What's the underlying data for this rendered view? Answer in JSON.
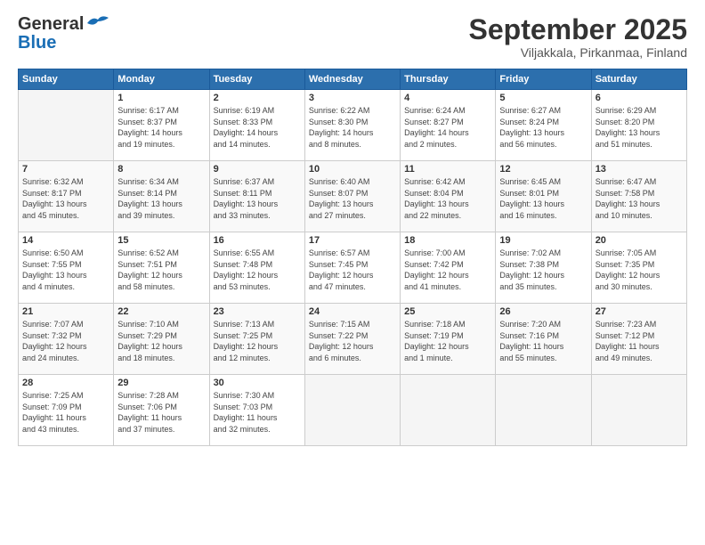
{
  "header": {
    "logo_line1": "General",
    "logo_line2": "Blue",
    "month_title": "September 2025",
    "location": "Viljakkala, Pirkanmaa, Finland"
  },
  "days_of_week": [
    "Sunday",
    "Monday",
    "Tuesday",
    "Wednesday",
    "Thursday",
    "Friday",
    "Saturday"
  ],
  "weeks": [
    [
      {
        "day": "",
        "content": ""
      },
      {
        "day": "1",
        "content": "Sunrise: 6:17 AM\nSunset: 8:37 PM\nDaylight: 14 hours\nand 19 minutes."
      },
      {
        "day": "2",
        "content": "Sunrise: 6:19 AM\nSunset: 8:33 PM\nDaylight: 14 hours\nand 14 minutes."
      },
      {
        "day": "3",
        "content": "Sunrise: 6:22 AM\nSunset: 8:30 PM\nDaylight: 14 hours\nand 8 minutes."
      },
      {
        "day": "4",
        "content": "Sunrise: 6:24 AM\nSunset: 8:27 PM\nDaylight: 14 hours\nand 2 minutes."
      },
      {
        "day": "5",
        "content": "Sunrise: 6:27 AM\nSunset: 8:24 PM\nDaylight: 13 hours\nand 56 minutes."
      },
      {
        "day": "6",
        "content": "Sunrise: 6:29 AM\nSunset: 8:20 PM\nDaylight: 13 hours\nand 51 minutes."
      }
    ],
    [
      {
        "day": "7",
        "content": "Sunrise: 6:32 AM\nSunset: 8:17 PM\nDaylight: 13 hours\nand 45 minutes."
      },
      {
        "day": "8",
        "content": "Sunrise: 6:34 AM\nSunset: 8:14 PM\nDaylight: 13 hours\nand 39 minutes."
      },
      {
        "day": "9",
        "content": "Sunrise: 6:37 AM\nSunset: 8:11 PM\nDaylight: 13 hours\nand 33 minutes."
      },
      {
        "day": "10",
        "content": "Sunrise: 6:40 AM\nSunset: 8:07 PM\nDaylight: 13 hours\nand 27 minutes."
      },
      {
        "day": "11",
        "content": "Sunrise: 6:42 AM\nSunset: 8:04 PM\nDaylight: 13 hours\nand 22 minutes."
      },
      {
        "day": "12",
        "content": "Sunrise: 6:45 AM\nSunset: 8:01 PM\nDaylight: 13 hours\nand 16 minutes."
      },
      {
        "day": "13",
        "content": "Sunrise: 6:47 AM\nSunset: 7:58 PM\nDaylight: 13 hours\nand 10 minutes."
      }
    ],
    [
      {
        "day": "14",
        "content": "Sunrise: 6:50 AM\nSunset: 7:55 PM\nDaylight: 13 hours\nand 4 minutes."
      },
      {
        "day": "15",
        "content": "Sunrise: 6:52 AM\nSunset: 7:51 PM\nDaylight: 12 hours\nand 58 minutes."
      },
      {
        "day": "16",
        "content": "Sunrise: 6:55 AM\nSunset: 7:48 PM\nDaylight: 12 hours\nand 53 minutes."
      },
      {
        "day": "17",
        "content": "Sunrise: 6:57 AM\nSunset: 7:45 PM\nDaylight: 12 hours\nand 47 minutes."
      },
      {
        "day": "18",
        "content": "Sunrise: 7:00 AM\nSunset: 7:42 PM\nDaylight: 12 hours\nand 41 minutes."
      },
      {
        "day": "19",
        "content": "Sunrise: 7:02 AM\nSunset: 7:38 PM\nDaylight: 12 hours\nand 35 minutes."
      },
      {
        "day": "20",
        "content": "Sunrise: 7:05 AM\nSunset: 7:35 PM\nDaylight: 12 hours\nand 30 minutes."
      }
    ],
    [
      {
        "day": "21",
        "content": "Sunrise: 7:07 AM\nSunset: 7:32 PM\nDaylight: 12 hours\nand 24 minutes."
      },
      {
        "day": "22",
        "content": "Sunrise: 7:10 AM\nSunset: 7:29 PM\nDaylight: 12 hours\nand 18 minutes."
      },
      {
        "day": "23",
        "content": "Sunrise: 7:13 AM\nSunset: 7:25 PM\nDaylight: 12 hours\nand 12 minutes."
      },
      {
        "day": "24",
        "content": "Sunrise: 7:15 AM\nSunset: 7:22 PM\nDaylight: 12 hours\nand 6 minutes."
      },
      {
        "day": "25",
        "content": "Sunrise: 7:18 AM\nSunset: 7:19 PM\nDaylight: 12 hours\nand 1 minute."
      },
      {
        "day": "26",
        "content": "Sunrise: 7:20 AM\nSunset: 7:16 PM\nDaylight: 11 hours\nand 55 minutes."
      },
      {
        "day": "27",
        "content": "Sunrise: 7:23 AM\nSunset: 7:12 PM\nDaylight: 11 hours\nand 49 minutes."
      }
    ],
    [
      {
        "day": "28",
        "content": "Sunrise: 7:25 AM\nSunset: 7:09 PM\nDaylight: 11 hours\nand 43 minutes."
      },
      {
        "day": "29",
        "content": "Sunrise: 7:28 AM\nSunset: 7:06 PM\nDaylight: 11 hours\nand 37 minutes."
      },
      {
        "day": "30",
        "content": "Sunrise: 7:30 AM\nSunset: 7:03 PM\nDaylight: 11 hours\nand 32 minutes."
      },
      {
        "day": "",
        "content": ""
      },
      {
        "day": "",
        "content": ""
      },
      {
        "day": "",
        "content": ""
      },
      {
        "day": "",
        "content": ""
      }
    ]
  ]
}
